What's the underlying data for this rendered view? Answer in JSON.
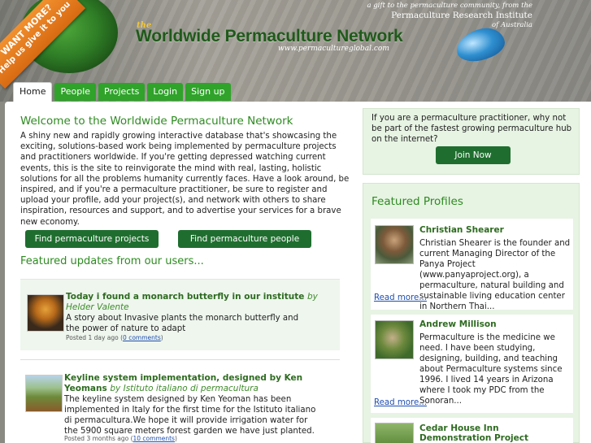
{
  "header": {
    "corner_banner_line1": "WANT MORE?",
    "corner_banner_line2": "Help us give it to you",
    "logo_the": "the",
    "logo_title": "Worldwide Permaculture Network",
    "logo_url": "www.permacultureglobal.com",
    "gift_line1": "a gift to the permaculture community, from the",
    "gift_line2": "Permaculture Research Institute",
    "gift_line3": "of Australia"
  },
  "nav": {
    "tabs": [
      {
        "label": "Home",
        "active": true
      },
      {
        "label": "People"
      },
      {
        "label": "Projects"
      },
      {
        "label": "Login"
      },
      {
        "label": "Sign up"
      }
    ]
  },
  "main": {
    "welcome_title": "Welcome to the Worldwide Permaculture Network",
    "intro": "A shiny new and rapidly growing interactive database that's showcasing the exciting, solutions-based work being implemented by permaculture projects and practitioners worldwide. If you're getting depressed watching current events, this is the site to reinvigorate the mind with real, lasting, holistic solutions for all the problems humanity currently faces. Have a look around, be inspired, and if you're a permaculture practitioner, be sure to register and upload your profile, add your project(s), and network with others to share inspiration, resources and support, and to advertise your services for a brave new economy.",
    "find_projects_label": "Find permaculture projects",
    "find_people_label": "Find permaculture people",
    "updates_title": "Featured updates from our users...",
    "updates": [
      {
        "title": "Today i found a monarch butterfly in our institute",
        "by": "by Helder Valente",
        "body": "A story about Invasive plants the monarch butterfly and the power of nature to adapt",
        "posted": "Posted 1 day ago (",
        "comments": "0 comments",
        "close": ")"
      },
      {
        "title": "Keyline system implementation, designed by Ken Yeomans",
        "by": "by Istituto italiano di permacultura",
        "body": "The keyline system designed by Ken Yeoman has been implemented in Italy for the first time for the Istituto italiano di permacultura.We hope it will provide irrigation water for the 5900 square meters forest garden we have just planted.",
        "posted": "Posted 3 months ago (",
        "comments": "10 comments",
        "close": ")"
      }
    ]
  },
  "sidebar": {
    "cta_text": "If you are a permaculture practitioner, why not be part of the fastest growing permaculture hub on the internet?",
    "join_label": "Join Now",
    "featured_title": "Featured Profiles",
    "profiles": [
      {
        "name": "Christian Shearer",
        "bio": "Christian Shearer is the founder and current Managing Director of the Panya Project (www.panyaproject.org), a permaculture, natural building and sustainable living education center in Northern Thai...",
        "read_more": "Read more..."
      },
      {
        "name": "Andrew Millison",
        "bio": "Permaculture is the medicine we need. I have been studying, designing, building, and teaching about Permaculture systems since 1996. I lived 14 years in Arizona where I took my PDC from the Sonoran...",
        "read_more": "Read more..."
      },
      {
        "name": "Cedar House Inn Demonstration Project",
        "bio": "",
        "read_more": ""
      }
    ]
  },
  "colors": {
    "accent_green": "#2e8b21",
    "button_dark_green": "#1f6e2f",
    "nav_green": "#2fa32a",
    "panel_green": "#e7f3e3",
    "link_blue": "#1f4fb0",
    "banner_orange": "#e57c1c"
  }
}
